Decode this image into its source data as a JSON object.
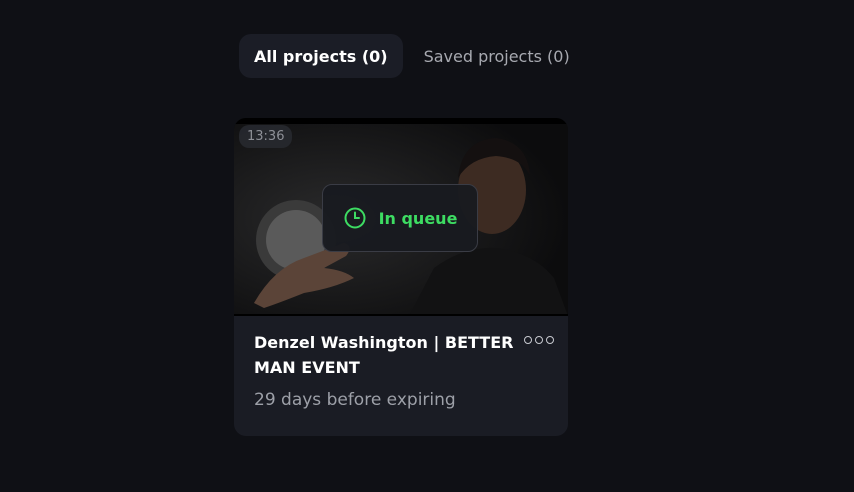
{
  "tabs": [
    {
      "label": "All projects (0)",
      "active": true
    },
    {
      "label": "Saved projects (0)",
      "active": false
    }
  ],
  "card": {
    "duration": "13:36",
    "status": "In queue",
    "status_icon": "clock-icon",
    "title": "Denzel Washington | BETTER MAN EVENT",
    "expiry": "29 days before expiring",
    "more_icon": "more-options-icon",
    "status_color": "#3ddc62"
  }
}
